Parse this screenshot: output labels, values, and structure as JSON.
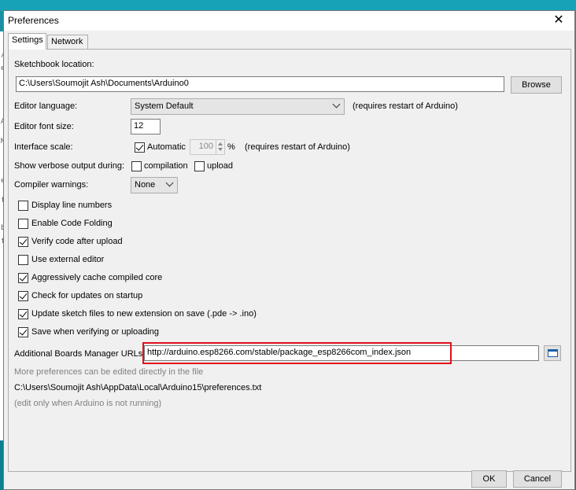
{
  "dialog": {
    "title": "Preferences",
    "close_glyph": "✕"
  },
  "tabs": [
    {
      "label": "Settings",
      "active": true
    },
    {
      "label": "Network",
      "active": false
    }
  ],
  "settings": {
    "sketchbook_label": "Sketchbook location:",
    "sketchbook_value": "C:\\Users\\Soumojit Ash\\Documents\\Arduino0",
    "browse_label": "Browse",
    "editor_language_label": "Editor language:",
    "editor_language_value": "System Default",
    "editor_language_note": "(requires restart of Arduino)",
    "font_size_label": "Editor font size:",
    "font_size_value": "12",
    "interface_scale_label": "Interface scale:",
    "automatic_label": "Automatic",
    "automatic_checked": true,
    "scale_value": "100",
    "scale_unit": "%",
    "scale_note": "(requires restart of Arduino)",
    "verbose_label": "Show verbose output during:",
    "verbose_compilation_label": "compilation",
    "verbose_upload_label": "upload",
    "compiler_warnings_label": "Compiler warnings:",
    "compiler_warnings_value": "None",
    "options": [
      {
        "label": "Display line numbers",
        "checked": false
      },
      {
        "label": "Enable Code Folding",
        "checked": false
      },
      {
        "label": "Verify code after upload",
        "checked": true
      },
      {
        "label": "Use external editor",
        "checked": false
      },
      {
        "label": "Aggressively cache compiled core",
        "checked": true
      },
      {
        "label": "Check for updates on startup",
        "checked": true
      },
      {
        "label": "Update sketch files to new extension on save (.pde -> .ino)",
        "checked": true
      },
      {
        "label": "Save when verifying or uploading",
        "checked": true
      }
    ],
    "boards_url_label": "Additional Boards Manager URLs:",
    "boards_url_value": "http://arduino.esp8266.com/stable/package_esp8266com_index.json",
    "more_prefs_note": "More preferences can be edited directly in the file",
    "prefs_path": "C:\\Users\\Soumojit Ash\\AppData\\Local\\Arduino15\\preferences.txt",
    "edit_note": "(edit only when Arduino is not running)"
  },
  "buttons": {
    "ok_label": "OK",
    "cancel_label": "Cancel"
  },
  "background_editor": {
    "visible_chars": [
      "/",
      "e",
      "A",
      "M",
      "e",
      "f",
      "b",
      "f"
    ]
  },
  "colors": {
    "highlight_border": "#e0101e",
    "background_teal": "#17a2b8"
  }
}
